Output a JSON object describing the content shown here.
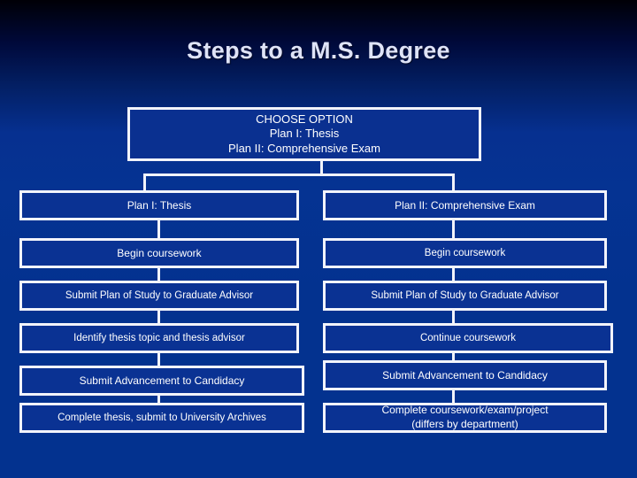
{
  "slide": {
    "title": "Steps to a M.S. Degree",
    "background_top_color": "#000006",
    "background_bottom_color": "#03328f",
    "box_fill_color": "#0a3293",
    "box_border_color": "#f2f4fb",
    "text_color": "#ffffff",
    "title_color": "#dfe3f7"
  },
  "chart": {
    "root": {
      "lines": "CHOOSE OPTION\nPlan I:  Thesis\nPlan II: Comprehensive Exam",
      "line1": "CHOOSE OPTION",
      "line2": "Plan I:  Thesis",
      "line3": "Plan II: Comprehensive Exam"
    },
    "columns": [
      {
        "header": "Plan I:  Thesis",
        "steps": [
          "Begin coursework",
          "Submit Plan of Study to Graduate Advisor",
          "Identify thesis topic and thesis advisor",
          "Submit Advancement to Candidacy",
          "Complete thesis, submit to University Archives"
        ]
      },
      {
        "header": "Plan II: Comprehensive Exam",
        "steps": [
          "Begin coursework",
          "Submit Plan of Study to Graduate Advisor",
          "Continue coursework",
          "Submit Advancement to Candidacy",
          "Complete coursework/exam/project\n(differs by department)"
        ]
      }
    ]
  }
}
